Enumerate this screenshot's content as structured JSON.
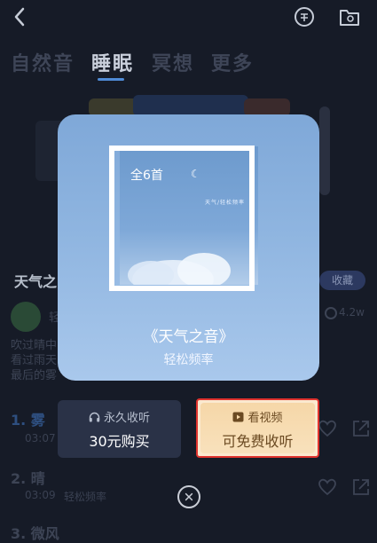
{
  "tabs": [
    "自然音",
    "睡眠",
    "冥想",
    "更多"
  ],
  "background": {
    "playlist_title": "天气之",
    "collect_label": "收藏",
    "play_count": "4.2w",
    "desc_lines": [
      "吹过晴中",
      "看过雨天",
      "最后的雾"
    ],
    "author_prefix": "轻",
    "tracks": [
      {
        "index_title": "1. 雾",
        "time": "03:07",
        "artist": ""
      },
      {
        "index_title": "2. 晴",
        "time": "03:09",
        "artist": "轻松频率"
      },
      {
        "index_title": "3. 微风",
        "time": "",
        "artist": ""
      }
    ]
  },
  "modal": {
    "count_label": "全6首",
    "cover_small_text": "天气/轻松频率",
    "album_title": "《天气之音》",
    "album_subtitle": "轻松频率"
  },
  "buy_button": {
    "line1": "永久收听",
    "line2": "30元购买"
  },
  "video_button": {
    "line1": "看视频",
    "line2": "可免费收听"
  },
  "colors": {
    "accent": "#4f8bd6",
    "highlight_border": "#e0332e",
    "gold": "#f6d7a8"
  }
}
